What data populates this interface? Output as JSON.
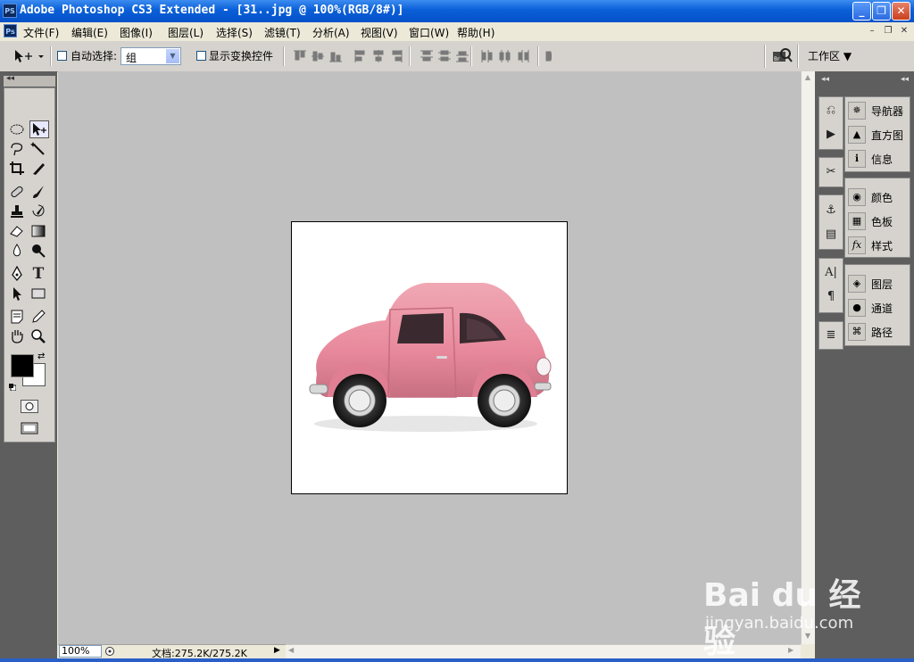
{
  "window": {
    "app_icon": "PS",
    "title": "Adobe Photoshop CS3 Extended - [31..jpg @ 100%(RGB/8#)]",
    "controls": {
      "minimize": "_",
      "maximize": "❐",
      "close": "✕"
    }
  },
  "menu": {
    "doc_icon": "Ps",
    "items": [
      {
        "label": "文件(F)"
      },
      {
        "label": "编辑(E)"
      },
      {
        "label": "图像(I)"
      },
      {
        "label": "图层(L)"
      },
      {
        "label": "选择(S)"
      },
      {
        "label": "滤镜(T)"
      },
      {
        "label": "分析(A)"
      },
      {
        "label": "视图(V)"
      },
      {
        "label": "窗口(W)"
      },
      {
        "label": "帮助(H)"
      }
    ],
    "mdi_controls": {
      "minimize": "–",
      "restore": "❐",
      "close": "✕"
    }
  },
  "options_bar": {
    "auto_select_label": "自动选择:",
    "auto_select_value": "组",
    "show_transform_label": "显示变换控件",
    "workspace_label": "工作区 ▼"
  },
  "toolbox": {
    "collapse": "◂◂"
  },
  "document": {
    "zoom": "100%",
    "doc_info": "文档:275.2K/275.2K",
    "image_subject": "pink-car"
  },
  "right_dock": {
    "collapse": "◂◂",
    "panels": [
      {
        "icon": "navigator-icon",
        "label": "导航器"
      },
      {
        "icon": "histogram-icon",
        "label": "直方图"
      },
      {
        "icon": "info-icon",
        "label": "信息"
      },
      {
        "icon": "color-icon",
        "label": "颜色"
      },
      {
        "icon": "swatches-icon",
        "label": "色板"
      },
      {
        "icon": "styles-icon",
        "label": "样式"
      },
      {
        "icon": "layers-icon",
        "label": "图层"
      },
      {
        "icon": "channels-icon",
        "label": "通道"
      },
      {
        "icon": "paths-icon",
        "label": "路径"
      }
    ]
  },
  "watermark": {
    "logo": "Bai du 经验",
    "url": "jingyan.baidu.com"
  },
  "colors": {
    "titlebar": "#0a5fd8",
    "workspace_gray": "#c0c0c0",
    "panel_dark": "#5e5e5e",
    "car_pink": "#e8899c"
  }
}
